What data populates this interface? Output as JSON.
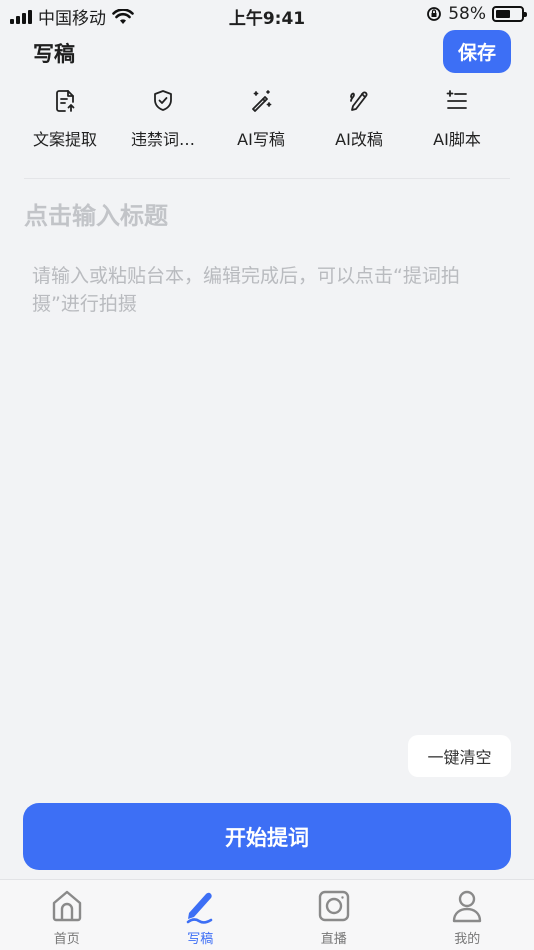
{
  "status_bar": {
    "carrier": "中国移动",
    "time": "上午9:41",
    "battery": "58%",
    "battery_level": 0.58
  },
  "header": {
    "title": "写稿",
    "save_label": "保存"
  },
  "toolbar": {
    "items": [
      {
        "label": "文案提取",
        "icon": "document-extract-icon"
      },
      {
        "label": "违禁词…",
        "icon": "shield-check-icon"
      },
      {
        "label": "AI写稿",
        "icon": "magic-wand-icon"
      },
      {
        "label": "AI改稿",
        "icon": "pen-icon"
      },
      {
        "label": "AI脚本",
        "icon": "list-sparkle-icon"
      }
    ]
  },
  "editor": {
    "title_placeholder": "点击输入标题",
    "body_placeholder": "请输入或粘贴台本，编辑完成后，可以点击“提词拍摄”进行拍摄"
  },
  "actions": {
    "clear_label": "一键清空",
    "start_label": "开始提词"
  },
  "tabbar": {
    "items": [
      {
        "label": "首页",
        "icon": "home-icon",
        "active": false
      },
      {
        "label": "写稿",
        "icon": "write-icon",
        "active": true
      },
      {
        "label": "直播",
        "icon": "live-camera-icon",
        "active": false
      },
      {
        "label": "我的",
        "icon": "profile-icon",
        "active": false
      }
    ]
  },
  "colors": {
    "accent": "#3d6ff5",
    "background": "#f2f3f5"
  }
}
